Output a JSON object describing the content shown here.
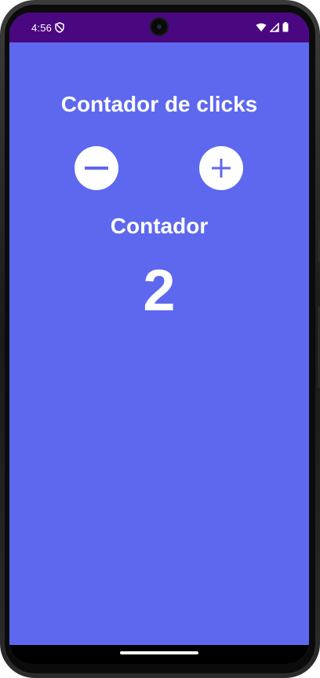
{
  "status_bar": {
    "time": "4:56",
    "icons": [
      "shield-icon",
      "wifi-icon",
      "signal-icon",
      "battery-icon"
    ],
    "background": "#4a0880"
  },
  "app": {
    "title": "Contador de clicks",
    "background": "#5d68ee",
    "decrement_icon": "minus-icon",
    "increment_icon": "plus-icon",
    "counter_label": "Contador",
    "counter_value": "2"
  },
  "colors": {
    "accent": "#5d68ee",
    "button_bg": "#ffffff",
    "text": "#ffffff"
  }
}
